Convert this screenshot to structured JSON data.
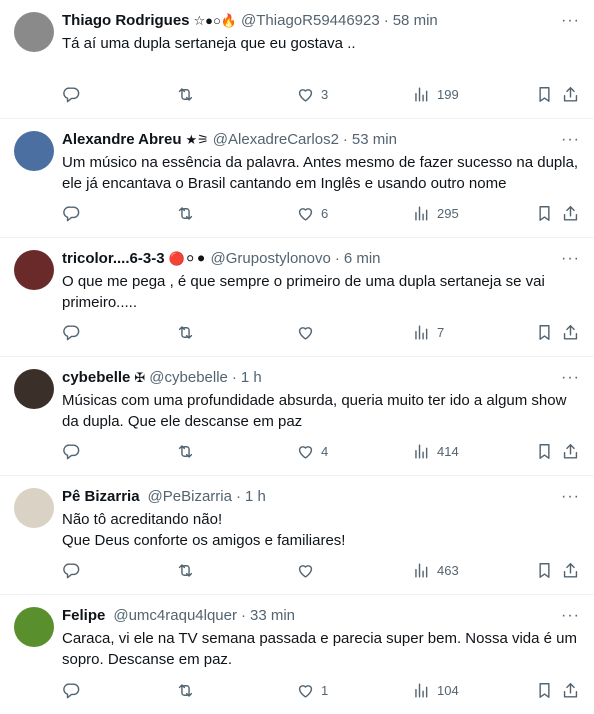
{
  "tweets": [
    {
      "name": "Thiago Rodrigues",
      "badge": "☆●○🔥",
      "handle": "@ThiagoR59446923",
      "time": "58 min",
      "text": "Tá aí uma dupla sertaneja que eu gostava ..",
      "replies": "",
      "retweets": "",
      "likes": "3",
      "views": "199",
      "avatar_color": "#8a8a8a"
    },
    {
      "name": "Alexandre Abreu",
      "badge": "★⚞",
      "handle": "@AlexadreCarlos2",
      "time": "53 min",
      "text": "Um músico na essência da palavra. Antes mesmo de fazer sucesso na dupla, ele já encantava o Brasil cantando em Inglês e usando outro nome",
      "replies": "",
      "retweets": "",
      "likes": "6",
      "views": "295",
      "avatar_color": "#4a6fa0"
    },
    {
      "name": "tricolor....6-3-3",
      "badge": "🔴⚪⚫",
      "handle": "@Grupostylonovo",
      "time": "6 min",
      "text": "O que me pega , é que sempre o primeiro de uma dupla sertaneja se vai primeiro.....",
      "replies": "",
      "retweets": "",
      "likes": "",
      "views": "7",
      "avatar_color": "#6b2a2a"
    },
    {
      "name": "cybebelle",
      "badge": "✠",
      "handle": "@cybebelle",
      "time": "1 h",
      "text": "Músicas com uma profundidade absurda, queria muito ter ido a algum show da dupla. Que ele descanse em paz",
      "replies": "",
      "retweets": "",
      "likes": "4",
      "views": "414",
      "avatar_color": "#3b2f2a"
    },
    {
      "name": "Pê Bizarria",
      "badge": "",
      "handle": "@PeBizarria",
      "time": "1 h",
      "text": "Não tô acreditando não!\nQue Deus conforte os amigos e familiares!",
      "replies": "",
      "retweets": "",
      "likes": "",
      "views": "463",
      "avatar_color": "#d9d2c5"
    },
    {
      "name": "Felipe",
      "badge": "",
      "handle": "@umc4raqu4lquer",
      "time": "33 min",
      "text": "Caraca, vi ele na TV semana passada e parecia super bem. Nossa vida é um sopro. Descanse em paz.",
      "replies": "",
      "retweets": "",
      "likes": "1",
      "views": "104",
      "avatar_color": "#5a8f2e"
    }
  ],
  "ui": {
    "dot": "·",
    "more": "···"
  },
  "icons": {
    "reply": "reply-icon",
    "retweet": "retweet-icon",
    "like": "heart-icon",
    "views": "views-icon",
    "bookmark": "bookmark-icon",
    "share": "share-icon"
  },
  "colors": {
    "secondary_text": "#536471",
    "primary_text": "#0f1419",
    "divider": "#eff3f4"
  }
}
